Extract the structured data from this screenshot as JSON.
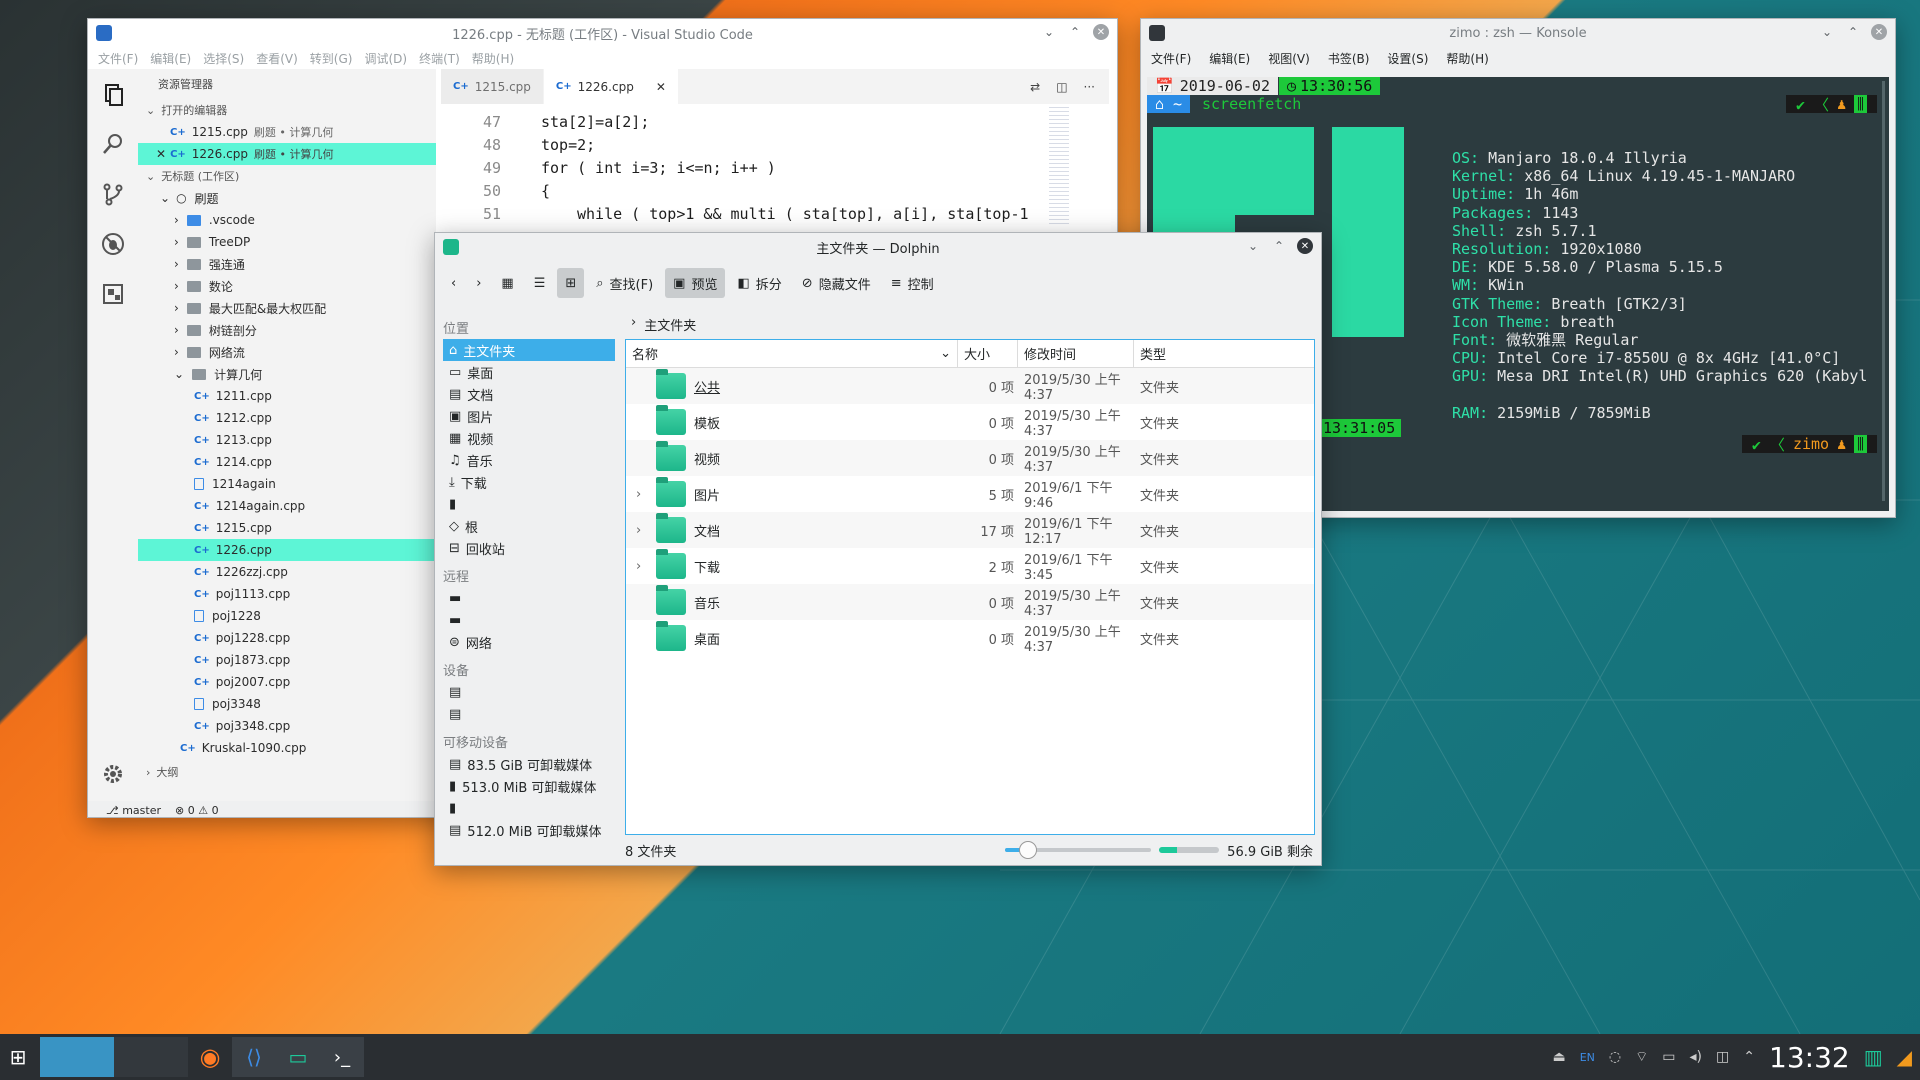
{
  "vscode": {
    "title": "1226.cpp - 无标题 (工作区) - Visual Studio Code",
    "menu": [
      "文件(F)",
      "编辑(E)",
      "选择(S)",
      "查看(V)",
      "转到(G)",
      "调试(D)",
      "终端(T)",
      "帮助(H)"
    ],
    "explorer_label": "资源管理器",
    "open_editors_label": "打开的编辑器",
    "open_editors": [
      {
        "name": "1215.cpp",
        "desc": "刷题 • 计算几何"
      },
      {
        "name": "1226.cpp",
        "desc": "刷题 • 计算几何"
      }
    ],
    "workspace_label": "无标题 (工作区)",
    "root_folder": "刷题",
    "folders": [
      ".vscode",
      "TreeDP",
      "强连通",
      "数论",
      "最大匹配&最大权匹配",
      "树链剖分",
      "网络流",
      "计算几何"
    ],
    "files": [
      "1211.cpp",
      "1212.cpp",
      "1213.cpp",
      "1214.cpp",
      "1214again",
      "1214again.cpp",
      "1215.cpp",
      "1226.cpp",
      "1226zzj.cpp",
      "poj1113.cpp",
      "poj1228",
      "poj1228.cpp",
      "poj1873.cpp",
      "poj2007.cpp",
      "poj3348",
      "poj3348.cpp"
    ],
    "extra_file": "Kruskal-1090.cpp",
    "outline_label": "大纲",
    "tabs": [
      "1215.cpp",
      "1226.cpp"
    ],
    "code_lines": [
      {
        "n": "47",
        "t": "sta[2]=a[2];"
      },
      {
        "n": "48",
        "t": "top=2;"
      },
      {
        "n": "49",
        "t": "for ( int i=3; i<=n; i++ )"
      },
      {
        "n": "50",
        "t": "{"
      },
      {
        "n": "51",
        "t": "while ( top>1 && multi ( sta[top], a[i], sta[top-1"
      }
    ],
    "branch": "master",
    "errors": "0",
    "warnings": "0"
  },
  "konsole": {
    "title": "zimo : zsh — Konsole",
    "menu": [
      "文件(F)",
      "编辑(E)",
      "视图(V)",
      "书签(B)",
      "设置(S)",
      "帮助(H)"
    ],
    "date": "2019-06-02",
    "time": "13:30:56",
    "command": "screenfetch",
    "time2": "13:31:05",
    "user": "zimo",
    "info": [
      {
        "k": "OS:",
        "v": " Manjaro 18.0.4 Illyria"
      },
      {
        "k": "Kernel:",
        "v": " x86_64 Linux 4.19.45-1-MANJARO"
      },
      {
        "k": "Uptime:",
        "v": " 1h 46m"
      },
      {
        "k": "Packages:",
        "v": " 1143"
      },
      {
        "k": "Shell:",
        "v": " zsh 5.7.1"
      },
      {
        "k": "Resolution:",
        "v": " 1920x1080"
      },
      {
        "k": "DE:",
        "v": " KDE 5.58.0 / Plasma 5.15.5"
      },
      {
        "k": "WM:",
        "v": " KWin"
      },
      {
        "k": "GTK Theme:",
        "v": " Breath [GTK2/3]"
      },
      {
        "k": "Icon Theme:",
        "v": " breath"
      },
      {
        "k": "Font:",
        "v": " 微软雅黑 Regular"
      },
      {
        "k": "CPU:",
        "v": " Intel Core i7-8550U @ 8x 4GHz [41.0°C]"
      },
      {
        "k": "GPU:",
        "v": " Mesa DRI Intel(R) UHD Graphics 620 (Kabyl"
      },
      {
        "k": "",
        "v": ""
      },
      {
        "k": "RAM:",
        "v": " 2159MiB / 7859MiB"
      }
    ]
  },
  "dolphin": {
    "title": "主文件夹 — Dolphin",
    "toolbar": {
      "find": "查找(F)",
      "preview": "预览",
      "split": "拆分",
      "hidden": "隐藏文件",
      "control": "控制"
    },
    "places_label": "位置",
    "places": [
      "主文件夹",
      "桌面",
      "文档",
      "图片",
      "视频",
      "音乐",
      "下载",
      "",
      "根",
      "回收站"
    ],
    "remote_label": "远程",
    "remote": [
      "",
      "",
      "网络"
    ],
    "devices_label": "设备",
    "removable_label": "可移动设备",
    "removable": [
      "83.5 GiB 可卸载媒体",
      "513.0 MiB 可卸载媒体",
      "",
      "512.0 MiB 可卸载媒体"
    ],
    "breadcrumb": "主文件夹",
    "columns": [
      "名称",
      "大小",
      "修改时间",
      "类型"
    ],
    "rows": [
      {
        "name": "公共",
        "size": "0 项",
        "mtime": "2019/5/30 上午4:37",
        "type": "文件夹"
      },
      {
        "name": "模板",
        "size": "0 项",
        "mtime": "2019/5/30 上午4:37",
        "type": "文件夹"
      },
      {
        "name": "视频",
        "size": "0 项",
        "mtime": "2019/5/30 上午4:37",
        "type": "文件夹"
      },
      {
        "name": "图片",
        "size": "5 项",
        "mtime": "2019/6/1 下午9:46",
        "type": "文件夹"
      },
      {
        "name": "文档",
        "size": "17 项",
        "mtime": "2019/6/1 下午12:17",
        "type": "文件夹"
      },
      {
        "name": "下载",
        "size": "2 项",
        "mtime": "2019/6/1 下午3:45",
        "type": "文件夹"
      },
      {
        "name": "音乐",
        "size": "0 项",
        "mtime": "2019/5/30 上午4:37",
        "type": "文件夹"
      },
      {
        "name": "桌面",
        "size": "0 项",
        "mtime": "2019/5/30 上午4:37",
        "type": "文件夹"
      }
    ],
    "status": "8 文件夹",
    "free": "56.9 GiB 剩余"
  },
  "taskbar": {
    "lang": "EN",
    "clock": "13:32"
  },
  "colors": {
    "accent": "#3daee9",
    "teal": "#1dc99a",
    "selection": "#5df5d6"
  }
}
